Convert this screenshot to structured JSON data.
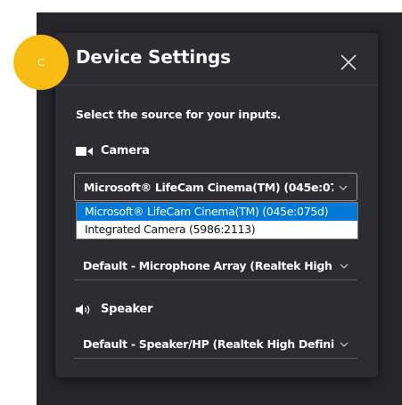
{
  "avatar": {
    "initial": "C",
    "color": "#f7bd15"
  },
  "dialog": {
    "title": "Device Settings",
    "close_icon": "close-icon",
    "instructions": "Select the source for your inputs."
  },
  "camera": {
    "label": "Camera",
    "icon": "video-camera-icon",
    "selected": "Microsoft® LifeCam Cinema(TM) (045e:075d)",
    "options": [
      {
        "label": "Microsoft® LifeCam Cinema(TM) (045e:075d)",
        "selected": true
      },
      {
        "label": "Integrated Camera (5986:2113)",
        "selected": false
      }
    ]
  },
  "microphone": {
    "selected": "Default - Microphone Array (Realtek High Definition Audio)"
  },
  "speaker": {
    "label": "Speaker",
    "icon": "speaker-icon",
    "selected": "Default - Speaker/HP (Realtek High Definition Audio)"
  },
  "colors": {
    "panel": "#2c2c31",
    "backdrop": "#25252a",
    "highlight": "#0078d7"
  }
}
